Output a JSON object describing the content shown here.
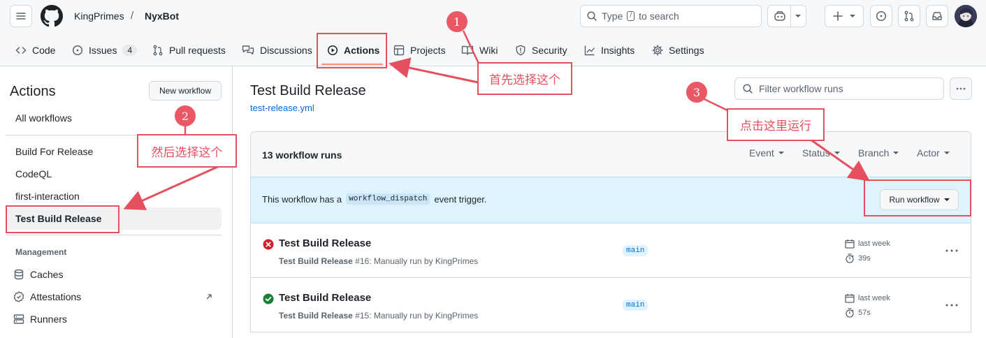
{
  "header": {
    "owner": "KingPrimes",
    "sep": "/",
    "repo": "NyxBot",
    "search_label": "Type",
    "search_key": "/",
    "search_rest": "to search"
  },
  "tabs": [
    {
      "label": "Code"
    },
    {
      "label": "Issues",
      "count": "4"
    },
    {
      "label": "Pull requests"
    },
    {
      "label": "Discussions"
    },
    {
      "label": "Actions"
    },
    {
      "label": "Projects"
    },
    {
      "label": "Wiki"
    },
    {
      "label": "Security"
    },
    {
      "label": "Insights"
    },
    {
      "label": "Settings"
    }
  ],
  "sidebar": {
    "title": "Actions",
    "new_workflow": "New workflow",
    "all": "All workflows",
    "workflows": [
      "Build For Release",
      "CodeQL",
      "first-interaction",
      "Test Build Release"
    ],
    "management_heading": "Management",
    "management": [
      "Caches",
      "Attestations",
      "Runners"
    ]
  },
  "main": {
    "title": "Test Build Release",
    "file": "test-release.yml",
    "filter_placeholder": "Filter workflow runs",
    "run_count": "13 workflow runs",
    "filters": [
      "Event",
      "Status",
      "Branch",
      "Actor"
    ],
    "dispatch_pre": "This workflow has a",
    "dispatch_code": "workflow_dispatch",
    "dispatch_post": "event trigger.",
    "run_button": "Run workflow"
  },
  "runs": [
    {
      "title": "Test Build Release",
      "name": "Test Build Release",
      "detail": "#16: Manually run by KingPrimes",
      "branch": "main",
      "when": "last week",
      "duration": "39s",
      "status": "failure"
    },
    {
      "title": "Test Build Release",
      "name": "Test Build Release",
      "detail": "#15: Manually run by KingPrimes",
      "branch": "main",
      "when": "last week",
      "duration": "57s",
      "status": "success"
    }
  ],
  "annotations": {
    "n1": "1",
    "t1": "首先选择这个",
    "n2": "2",
    "t2": "然后选择这个",
    "n3": "3",
    "t3": "点击这里运行"
  },
  "colors": {
    "accent": "#fd8c73",
    "annotation": "#e5505e",
    "banner": "#ddf4ff",
    "success": "#1a7f37",
    "failure": "#cf222e"
  }
}
